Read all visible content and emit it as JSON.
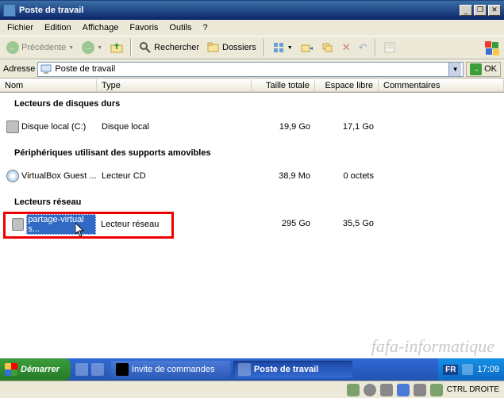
{
  "titlebar": {
    "title": "Poste de travail"
  },
  "menu": {
    "file": "Fichier",
    "edit": "Edition",
    "view": "Affichage",
    "fav": "Favoris",
    "tools": "Outils",
    "help": "?"
  },
  "toolbar": {
    "back": "Précédente",
    "search": "Rechercher",
    "folders": "Dossiers"
  },
  "address": {
    "label": "Adresse",
    "value": "Poste de travail",
    "go": "OK"
  },
  "columns": {
    "name": "Nom",
    "type": "Type",
    "total": "Taille totale",
    "free": "Espace libre",
    "comments": "Commentaires"
  },
  "groups": {
    "hdd": "Lecteurs de disques durs",
    "removable": "Périphériques utilisant des supports amovibles",
    "network": "Lecteurs réseau"
  },
  "rows": {
    "hdd": {
      "name": "Disque local (C:)",
      "type": "Disque local",
      "total": "19,9 Go",
      "free": "17,1 Go"
    },
    "cd": {
      "name": "VirtualBox Guest ...",
      "type": "Lecteur CD",
      "total": "38,9 Mo",
      "free": "0 octets"
    },
    "net": {
      "name": "partage-virtual s...",
      "type": "Lecteur réseau",
      "total": "295 Go",
      "free": "35,5 Go"
    }
  },
  "taskbar": {
    "start": "Démarrer",
    "task1": "Invite de commandes",
    "task2": "Poste de travail",
    "lang": "FR",
    "clock": "17:09"
  },
  "vm": {
    "ctrl": "CTRL DROITE"
  },
  "watermark": "fafa-informatique"
}
